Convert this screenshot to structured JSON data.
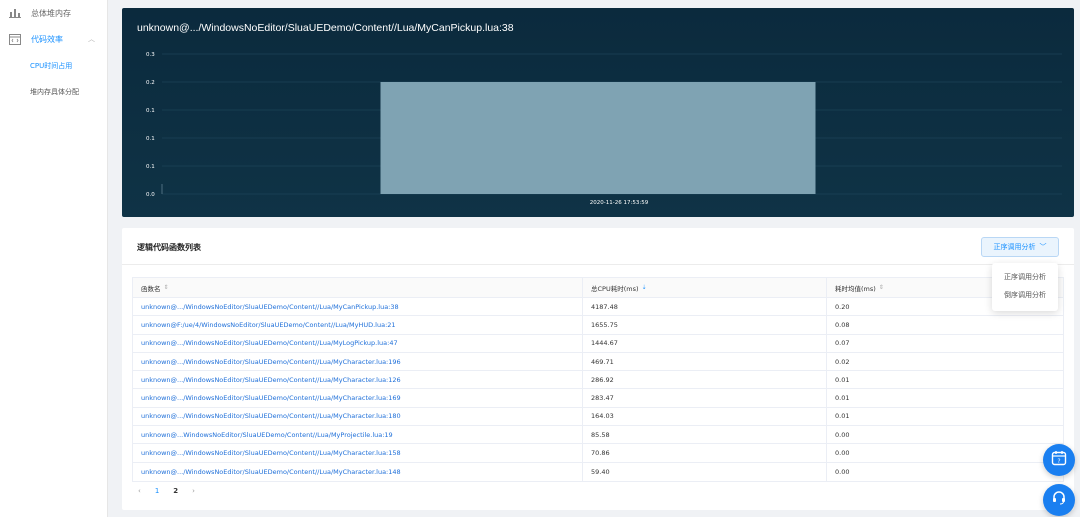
{
  "sidebar": {
    "items": [
      {
        "label": "总体堆内存",
        "icon": "bar-chart-icon"
      },
      {
        "label": "代码效率",
        "icon": "code-icon"
      }
    ],
    "subitems": [
      {
        "label": "CPU时间占用"
      },
      {
        "label": "堆内存具体分配"
      }
    ]
  },
  "chart_panel": {
    "title": "unknown@.../WindowsNoEditor/SluaUEDemo/Content//Lua/MyCanPickup.lua:38"
  },
  "chart_data": {
    "type": "bar",
    "title": "unknown@.../WindowsNoEditor/SluaUEDemo/Content//Lua/MyCanPickup.lua:38",
    "categories": [
      "2020-11-26 17:53:59"
    ],
    "values": [
      0.2
    ],
    "y_tick_labels": [
      "0.3",
      "0.2",
      "0.1",
      "0.1",
      "0.1",
      "0.0"
    ],
    "y_ticks": [
      0.25,
      0.2,
      0.15,
      0.1,
      0.05,
      0.0
    ],
    "ylim": [
      0,
      0.25
    ],
    "xlabel": "",
    "ylabel": "",
    "colors": {
      "bar": "#7fa3b3",
      "background": "#0d2f42",
      "grid": "#1c4357",
      "text": "#ffffff"
    }
  },
  "list": {
    "title": "逻辑代码函数列表",
    "analysis_button": "正序调用分析",
    "dropdown_options": [
      "正序调用分析",
      "倒序调用分析"
    ],
    "columns": [
      "函数名",
      "总CPU耗时(ms)",
      "耗时均值(ms)"
    ],
    "rows": [
      [
        "unknown@.../WindowsNoEditor/SluaUEDemo/Content//Lua/MyCanPickup.lua:38",
        "4187.48",
        "0.20"
      ],
      [
        "unknown@F:/ue/4/WindowsNoEditor/SluaUEDemo/Content//Lua/MyHUD.lua:21",
        "1655.75",
        "0.08"
      ],
      [
        "unknown@.../WindowsNoEditor/SluaUEDemo/Content//Lua/MyLogPickup.lua:47",
        "1444.67",
        "0.07"
      ],
      [
        "unknown@.../WindowsNoEditor/SluaUEDemo/Content//Lua/MyCharacter.lua:196",
        "469.71",
        "0.02"
      ],
      [
        "unknown@.../WindowsNoEditor/SluaUEDemo/Content//Lua/MyCharacter.lua:126",
        "286.92",
        "0.01"
      ],
      [
        "unknown@.../WindowsNoEditor/SluaUEDemo/Content//Lua/MyCharacter.lua:169",
        "283.47",
        "0.01"
      ],
      [
        "unknown@.../WindowsNoEditor/SluaUEDemo/Content//Lua/MyCharacter.lua:180",
        "164.03",
        "0.01"
      ],
      [
        "unknown@...WindowsNoEditor/SluaUEDemo/Content//Lua/MyProjectile.lua:19",
        "85.58",
        "0.00"
      ],
      [
        "unknown@.../WindowsNoEditor/SluaUEDemo/Content//Lua/MyCharacter.lua:158",
        "70.86",
        "0.00"
      ],
      [
        "unknown@.../WindowsNoEditor/SluaUEDemo/Content//Lua/MyCharacter.lua:148",
        "59.40",
        "0.00"
      ]
    ]
  },
  "pagination": {
    "prev": "‹",
    "pages": [
      "1",
      "2"
    ],
    "current": "1",
    "next": "›"
  },
  "colors": {
    "accent": "#1890ff",
    "link": "#1e6fd9",
    "fab": "#1a7ff0"
  }
}
